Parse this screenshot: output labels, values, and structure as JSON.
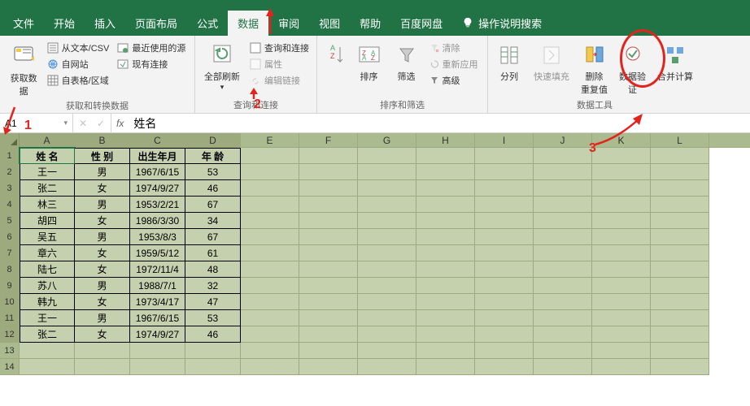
{
  "menu": {
    "items": [
      "文件",
      "开始",
      "插入",
      "页面布局",
      "公式",
      "数据",
      "审阅",
      "视图",
      "帮助",
      "百度网盘"
    ],
    "active": 5,
    "tell": "操作说明搜索"
  },
  "ribbon": {
    "g1": {
      "get_data": "获取数\n据",
      "csv": "从文本/CSV",
      "web": "自网站",
      "table": "自表格/区域",
      "recent": "最近使用的源",
      "exist": "现有连接",
      "label": "获取和转换数据"
    },
    "g2": {
      "refresh": "全部刷新",
      "query": "查询和连接",
      "prop": "属性",
      "link": "编辑链接",
      "label": "查询和连接"
    },
    "g3": {
      "sort": "排序",
      "filter": "筛选",
      "clear": "清除",
      "reapply": "重新应用",
      "adv": "高级",
      "label": "排序和筛选"
    },
    "g4": {
      "split": "分列",
      "flash": "快速填充",
      "remdup": "删除\n重复值",
      "valid": "数据验\n证",
      "consol": "合并计算",
      "label": "数据工具"
    }
  },
  "formula": {
    "name": "A1",
    "value": "姓名"
  },
  "columns": [
    "A",
    "B",
    "C",
    "D",
    "E",
    "F",
    "G",
    "H",
    "I",
    "J",
    "K",
    "L"
  ],
  "headers": [
    "姓 名",
    "性 别",
    "出生年月",
    "年 龄"
  ],
  "chart_data": {
    "type": "table",
    "rows": [
      [
        "王一",
        "男",
        "1967/6/15",
        "53"
      ],
      [
        "张二",
        "女",
        "1974/9/27",
        "46"
      ],
      [
        "林三",
        "男",
        "1953/2/21",
        "67"
      ],
      [
        "胡四",
        "女",
        "1986/3/30",
        "34"
      ],
      [
        "吴五",
        "男",
        "1953/8/3",
        "67"
      ],
      [
        "章六",
        "女",
        "1959/5/12",
        "61"
      ],
      [
        "陆七",
        "女",
        "1972/11/4",
        "48"
      ],
      [
        "苏八",
        "男",
        "1988/7/1",
        "32"
      ],
      [
        "韩九",
        "女",
        "1973/4/17",
        "47"
      ],
      [
        "王一",
        "男",
        "1967/6/15",
        "53"
      ],
      [
        "张二",
        "女",
        "1974/9/27",
        "46"
      ]
    ]
  }
}
